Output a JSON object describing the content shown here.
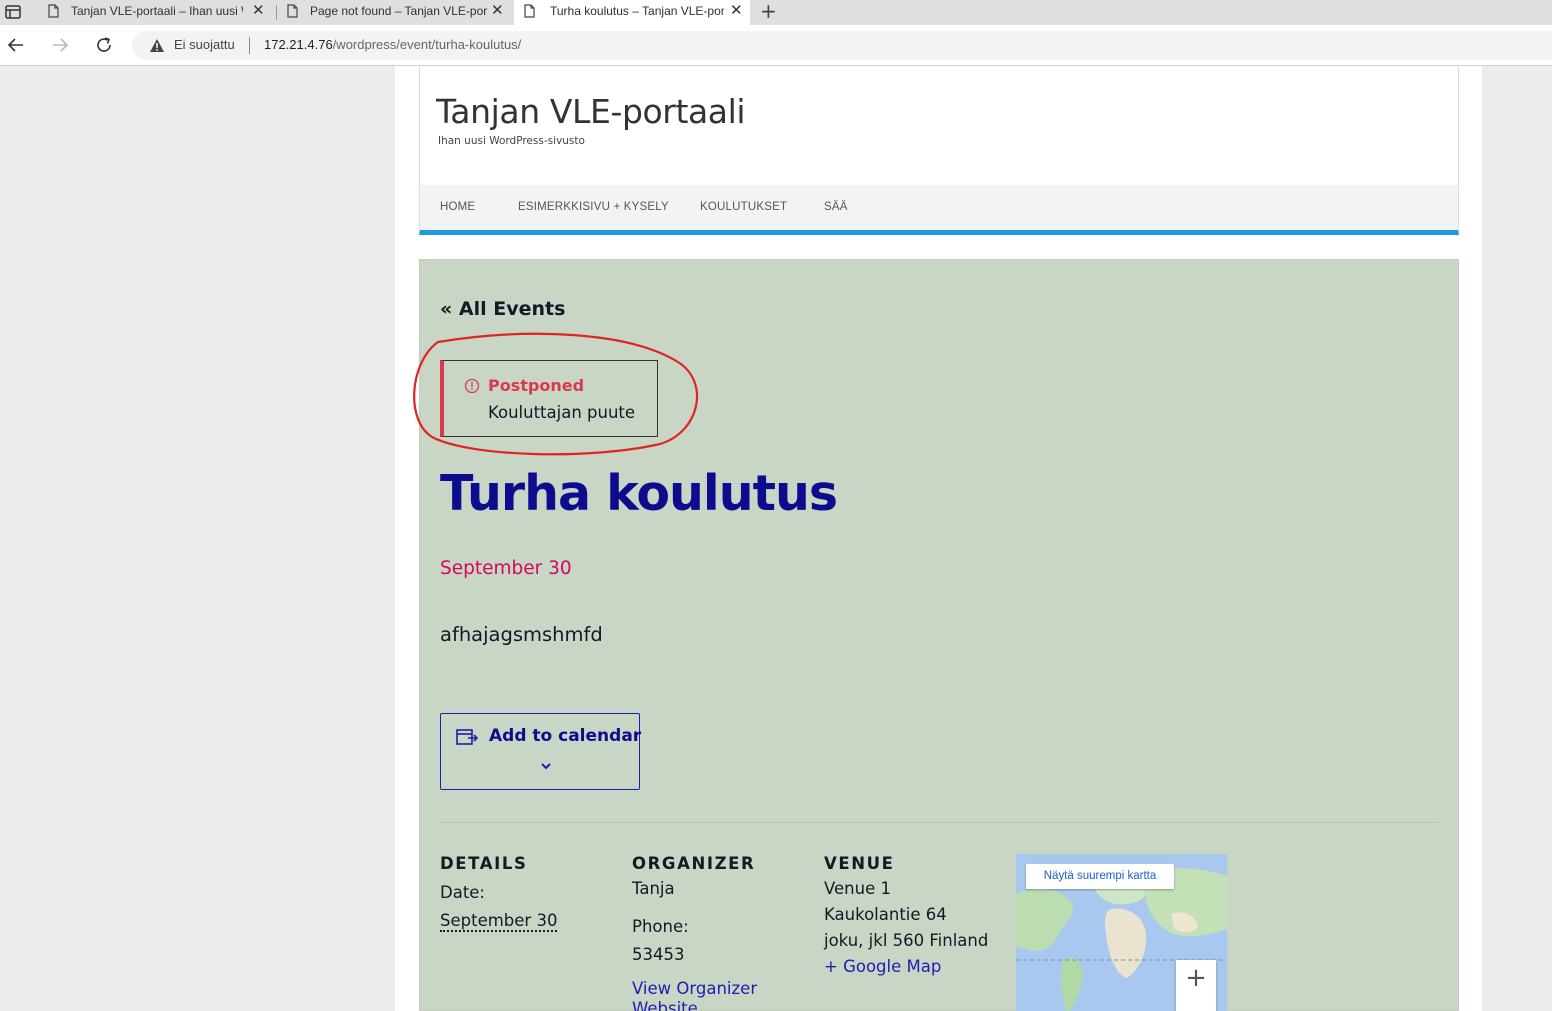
{
  "browser": {
    "tabs": [
      {
        "title": "Tanjan VLE-portaali – Ihan uusi W"
      },
      {
        "title": "Page not found – Tanjan VLE-por"
      },
      {
        "title": "Turha koulutus – Tanjan VLE-por"
      }
    ],
    "security_label": "Ei suojattu",
    "url_host": "172.21.4.76",
    "url_path": "/wordpress/event/turha-koulutus/"
  },
  "site": {
    "title": "Tanjan VLE-portaali",
    "description": "Ihan uusi WordPress-sivusto",
    "accent_color": "#1e9be0"
  },
  "nav": {
    "items": [
      "HOME",
      "ESIMERKKISIVU + KYSELY",
      "KOULUTUKSET",
      "SÄÄ"
    ]
  },
  "event": {
    "back_link": "« All Events",
    "notice_title": "Postponed",
    "notice_text": "Kouluttajan puute",
    "title": "Turha koulutus",
    "date": "September 30",
    "description": "afhajagsmshmfd",
    "add_to_calendar": "Add to calendar"
  },
  "details": {
    "heading": "DETAILS",
    "date_label": "Date:",
    "date_value": "September 30"
  },
  "organizer": {
    "heading": "ORGANIZER",
    "name": "Tanja",
    "phone_label": "Phone:",
    "phone_value": "53453",
    "website_link_line1": "View Organizer",
    "website_link_line2": "Website"
  },
  "venue": {
    "heading": "VENUE",
    "name": "Venue 1",
    "street": "Kaukolantie 64",
    "city_line": "joku, jkl 560 Finland",
    "map_link": "+ Google Map"
  },
  "map": {
    "larger_map_button": "Näytä suurempi kartta",
    "zoom_in": "+"
  }
}
